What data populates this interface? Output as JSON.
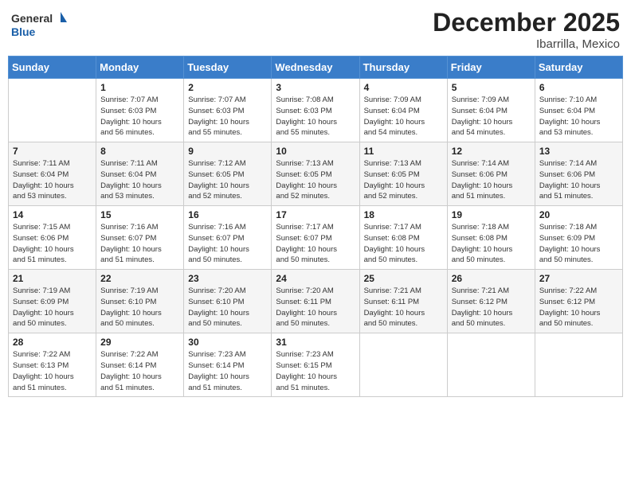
{
  "header": {
    "logo_line1": "General",
    "logo_line2": "Blue",
    "title": "December 2025",
    "subtitle": "Ibarrilla, Mexico"
  },
  "calendar": {
    "weekdays": [
      "Sunday",
      "Monday",
      "Tuesday",
      "Wednesday",
      "Thursday",
      "Friday",
      "Saturday"
    ],
    "weeks": [
      [
        {
          "day": "",
          "info": ""
        },
        {
          "day": "1",
          "info": "Sunrise: 7:07 AM\nSunset: 6:03 PM\nDaylight: 10 hours\nand 56 minutes."
        },
        {
          "day": "2",
          "info": "Sunrise: 7:07 AM\nSunset: 6:03 PM\nDaylight: 10 hours\nand 55 minutes."
        },
        {
          "day": "3",
          "info": "Sunrise: 7:08 AM\nSunset: 6:03 PM\nDaylight: 10 hours\nand 55 minutes."
        },
        {
          "day": "4",
          "info": "Sunrise: 7:09 AM\nSunset: 6:04 PM\nDaylight: 10 hours\nand 54 minutes."
        },
        {
          "day": "5",
          "info": "Sunrise: 7:09 AM\nSunset: 6:04 PM\nDaylight: 10 hours\nand 54 minutes."
        },
        {
          "day": "6",
          "info": "Sunrise: 7:10 AM\nSunset: 6:04 PM\nDaylight: 10 hours\nand 53 minutes."
        }
      ],
      [
        {
          "day": "7",
          "info": "Sunrise: 7:11 AM\nSunset: 6:04 PM\nDaylight: 10 hours\nand 53 minutes."
        },
        {
          "day": "8",
          "info": "Sunrise: 7:11 AM\nSunset: 6:04 PM\nDaylight: 10 hours\nand 53 minutes."
        },
        {
          "day": "9",
          "info": "Sunrise: 7:12 AM\nSunset: 6:05 PM\nDaylight: 10 hours\nand 52 minutes."
        },
        {
          "day": "10",
          "info": "Sunrise: 7:13 AM\nSunset: 6:05 PM\nDaylight: 10 hours\nand 52 minutes."
        },
        {
          "day": "11",
          "info": "Sunrise: 7:13 AM\nSunset: 6:05 PM\nDaylight: 10 hours\nand 52 minutes."
        },
        {
          "day": "12",
          "info": "Sunrise: 7:14 AM\nSunset: 6:06 PM\nDaylight: 10 hours\nand 51 minutes."
        },
        {
          "day": "13",
          "info": "Sunrise: 7:14 AM\nSunset: 6:06 PM\nDaylight: 10 hours\nand 51 minutes."
        }
      ],
      [
        {
          "day": "14",
          "info": "Sunrise: 7:15 AM\nSunset: 6:06 PM\nDaylight: 10 hours\nand 51 minutes."
        },
        {
          "day": "15",
          "info": "Sunrise: 7:16 AM\nSunset: 6:07 PM\nDaylight: 10 hours\nand 51 minutes."
        },
        {
          "day": "16",
          "info": "Sunrise: 7:16 AM\nSunset: 6:07 PM\nDaylight: 10 hours\nand 50 minutes."
        },
        {
          "day": "17",
          "info": "Sunrise: 7:17 AM\nSunset: 6:07 PM\nDaylight: 10 hours\nand 50 minutes."
        },
        {
          "day": "18",
          "info": "Sunrise: 7:17 AM\nSunset: 6:08 PM\nDaylight: 10 hours\nand 50 minutes."
        },
        {
          "day": "19",
          "info": "Sunrise: 7:18 AM\nSunset: 6:08 PM\nDaylight: 10 hours\nand 50 minutes."
        },
        {
          "day": "20",
          "info": "Sunrise: 7:18 AM\nSunset: 6:09 PM\nDaylight: 10 hours\nand 50 minutes."
        }
      ],
      [
        {
          "day": "21",
          "info": "Sunrise: 7:19 AM\nSunset: 6:09 PM\nDaylight: 10 hours\nand 50 minutes."
        },
        {
          "day": "22",
          "info": "Sunrise: 7:19 AM\nSunset: 6:10 PM\nDaylight: 10 hours\nand 50 minutes."
        },
        {
          "day": "23",
          "info": "Sunrise: 7:20 AM\nSunset: 6:10 PM\nDaylight: 10 hours\nand 50 minutes."
        },
        {
          "day": "24",
          "info": "Sunrise: 7:20 AM\nSunset: 6:11 PM\nDaylight: 10 hours\nand 50 minutes."
        },
        {
          "day": "25",
          "info": "Sunrise: 7:21 AM\nSunset: 6:11 PM\nDaylight: 10 hours\nand 50 minutes."
        },
        {
          "day": "26",
          "info": "Sunrise: 7:21 AM\nSunset: 6:12 PM\nDaylight: 10 hours\nand 50 minutes."
        },
        {
          "day": "27",
          "info": "Sunrise: 7:22 AM\nSunset: 6:12 PM\nDaylight: 10 hours\nand 50 minutes."
        }
      ],
      [
        {
          "day": "28",
          "info": "Sunrise: 7:22 AM\nSunset: 6:13 PM\nDaylight: 10 hours\nand 51 minutes."
        },
        {
          "day": "29",
          "info": "Sunrise: 7:22 AM\nSunset: 6:14 PM\nDaylight: 10 hours\nand 51 minutes."
        },
        {
          "day": "30",
          "info": "Sunrise: 7:23 AM\nSunset: 6:14 PM\nDaylight: 10 hours\nand 51 minutes."
        },
        {
          "day": "31",
          "info": "Sunrise: 7:23 AM\nSunset: 6:15 PM\nDaylight: 10 hours\nand 51 minutes."
        },
        {
          "day": "",
          "info": ""
        },
        {
          "day": "",
          "info": ""
        },
        {
          "day": "",
          "info": ""
        }
      ]
    ]
  }
}
